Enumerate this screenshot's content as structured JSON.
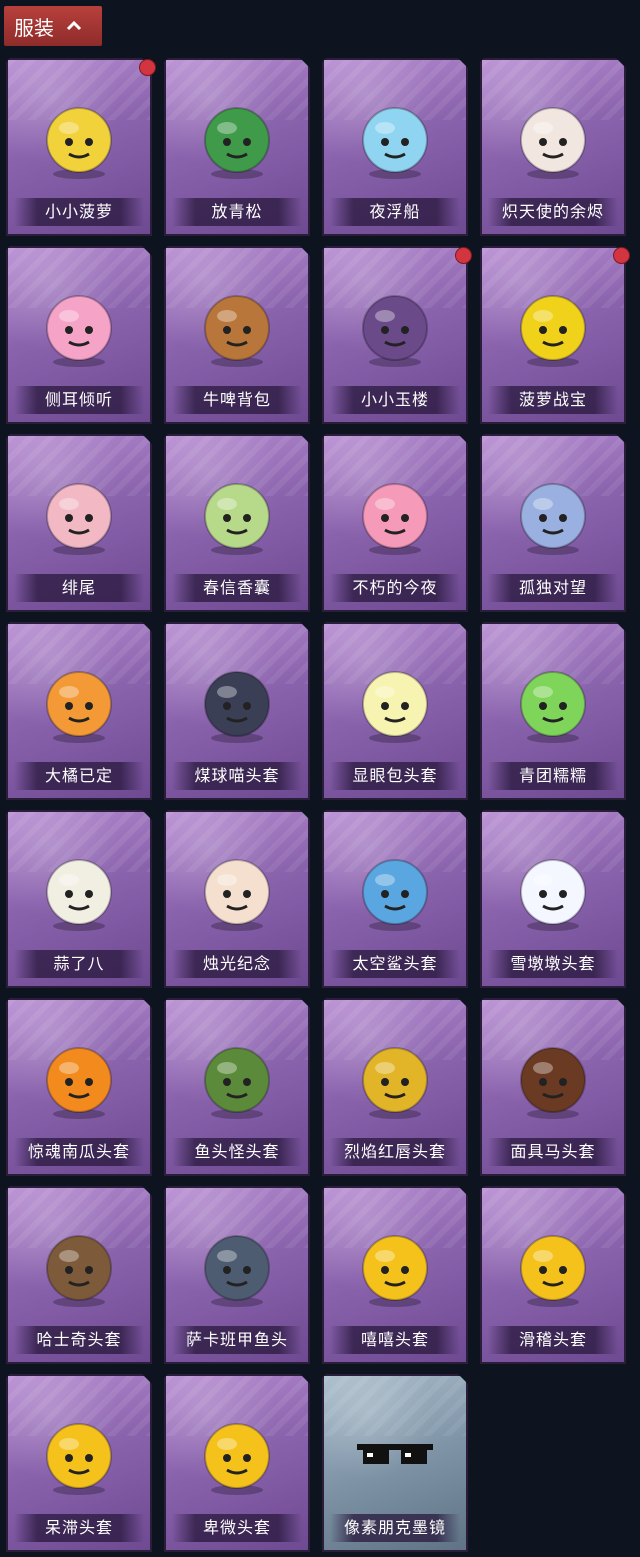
{
  "header": {
    "title": "服装"
  },
  "items": [
    {
      "name": "小小菠萝",
      "icon": "pineapple-costume-icon",
      "dot": true,
      "color": "#f2d23a"
    },
    {
      "name": "放青松",
      "icon": "bonsai-pine-icon",
      "dot": false,
      "color": "#3f9a4a"
    },
    {
      "name": "夜浮船",
      "icon": "jellyfish-icon",
      "dot": false,
      "color": "#8fd4f0"
    },
    {
      "name": "炽天使的余烬",
      "icon": "angel-doll-icon",
      "dot": false,
      "color": "#f1e7e0"
    },
    {
      "name": "侧耳倾听",
      "icon": "lotus-wreath-icon",
      "dot": false,
      "color": "#f5a4c8"
    },
    {
      "name": "牛啤背包",
      "icon": "beer-barrel-cow-icon",
      "dot": false,
      "color": "#b8763a"
    },
    {
      "name": "小小玉楼",
      "icon": "hat-doll-icon",
      "dot": true,
      "color": "#6b4a8a"
    },
    {
      "name": "菠萝战宝",
      "icon": "pineapple-robot-icon",
      "dot": true,
      "color": "#f0d21a"
    },
    {
      "name": "绯尾",
      "icon": "fox-girl-charm-icon",
      "dot": false,
      "color": "#f2b8c4"
    },
    {
      "name": "春信香囊",
      "icon": "sachet-icon",
      "dot": false,
      "color": "#b7d98a"
    },
    {
      "name": "不朽的今夜",
      "icon": "cat-cup-icon",
      "dot": false,
      "color": "#f59ab8"
    },
    {
      "name": "孤独对望",
      "icon": "doll-charm-icon",
      "dot": false,
      "color": "#9ab0e0"
    },
    {
      "name": "大橘已定",
      "icon": "orange-slice-head-icon",
      "dot": false,
      "color": "#f39a36"
    },
    {
      "name": "煤球喵头套",
      "icon": "black-cat-head-icon",
      "dot": false,
      "color": "#3b3f55"
    },
    {
      "name": "显眼包头套",
      "icon": "lightbulb-head-icon",
      "dot": false,
      "color": "#f7f3b0"
    },
    {
      "name": "青团糯糯",
      "icon": "green-mochi-head-icon",
      "dot": false,
      "color": "#7fd45a"
    },
    {
      "name": "蒜了八",
      "icon": "garlic-head-icon",
      "dot": false,
      "color": "#f1eee2"
    },
    {
      "name": "烛光纪念",
      "icon": "candle-head-icon",
      "dot": false,
      "color": "#f5e0d0"
    },
    {
      "name": "太空鲨头套",
      "icon": "shark-head-icon",
      "dot": false,
      "color": "#5aa6e0"
    },
    {
      "name": "雪墩墩头套",
      "icon": "snowman-head-icon",
      "dot": false,
      "color": "#f4f7ff"
    },
    {
      "name": "惊魂南瓜头套",
      "icon": "pumpkin-head-icon",
      "dot": false,
      "color": "#f28a1e"
    },
    {
      "name": "鱼头怪头套",
      "icon": "fish-monster-head-icon",
      "dot": false,
      "color": "#5b8b3a"
    },
    {
      "name": "烈焰红唇头套",
      "icon": "pikachu-head-icon",
      "dot": false,
      "color": "#e2b428"
    },
    {
      "name": "面具马头套",
      "icon": "horse-mask-icon",
      "dot": false,
      "color": "#6a3a22"
    },
    {
      "name": "哈士奇头套",
      "icon": "husky-head-icon",
      "dot": false,
      "color": "#7c5a3a"
    },
    {
      "name": "萨卡班甲鱼头",
      "icon": "sacabambaspis-head-icon",
      "dot": false,
      "color": "#4d5c70"
    },
    {
      "name": "嘻嘻头套",
      "icon": "grin-emoji-head-icon",
      "dot": false,
      "color": "#f5c21c"
    },
    {
      "name": "滑稽头套",
      "icon": "funny-emoji-head-icon",
      "dot": false,
      "color": "#f5c21c"
    },
    {
      "name": "呆滞头套",
      "icon": "stare-emoji-head-icon",
      "dot": false,
      "color": "#f5c21c"
    },
    {
      "name": "卑微头套",
      "icon": "humble-emoji-head-icon",
      "dot": false,
      "color": "#f5c21c"
    },
    {
      "name": "像素朋克墨镜",
      "icon": "pixel-sunglasses-icon",
      "dot": false,
      "color": "#111111",
      "rarity": "blue"
    }
  ]
}
